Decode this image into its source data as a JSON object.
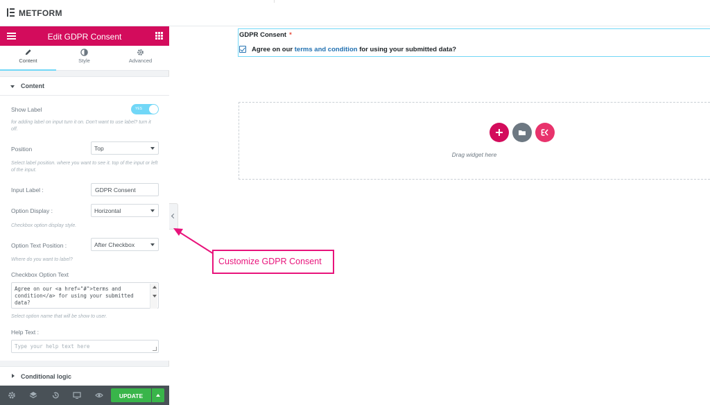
{
  "topbar": {
    "brand": "METFORM"
  },
  "panel": {
    "header_title": "Edit GDPR Consent",
    "tabs": [
      {
        "label": "Content"
      },
      {
        "label": "Style"
      },
      {
        "label": "Advanced"
      }
    ],
    "section_title": "Content",
    "show_label": {
      "label": "Show Label",
      "toggle_text": "YES",
      "on": true,
      "hint": "for adding label on input turn it on. Don't want to use label? turn it off."
    },
    "position": {
      "label": "Position",
      "value": "Top",
      "hint": "Select label position. where you want to see it. top of the input or left of the input."
    },
    "input_label": {
      "label": "Input Label :",
      "value": "GDPR Consent"
    },
    "option_display": {
      "label": "Option Display :",
      "value": "Horizontal",
      "hint": "Checkbox option display style."
    },
    "option_text_position": {
      "label": "Option Text Position :",
      "value": "After Checkbox",
      "hint": "Where do you want to label?"
    },
    "checkbox_option_text": {
      "label": "Checkbox Option Text",
      "value": "Agree on our <a href=\"#\">terms and condition</a> for using your submitted data?",
      "hint": "Select option name that will be show to user."
    },
    "help_text": {
      "label": "Help Text :",
      "placeholder": "Type your help text here"
    },
    "conditional_logic": "Conditional logic",
    "footer": {
      "update_label": "UPDATE"
    }
  },
  "canvas": {
    "widget": {
      "heading": "GDPR Consent",
      "required_mark": "*",
      "checked": true,
      "option_prefix": "Agree on our ",
      "option_link": "terms and condition",
      "option_suffix": " for using your submitted data?"
    },
    "drop_text": "Drag widget here"
  },
  "callout": {
    "text": "Customize GDPR Consent"
  },
  "colors": {
    "brand": "#d30c5c",
    "accent": "#71d7f7",
    "update": "#39b54a",
    "callout": "#e8137b"
  }
}
